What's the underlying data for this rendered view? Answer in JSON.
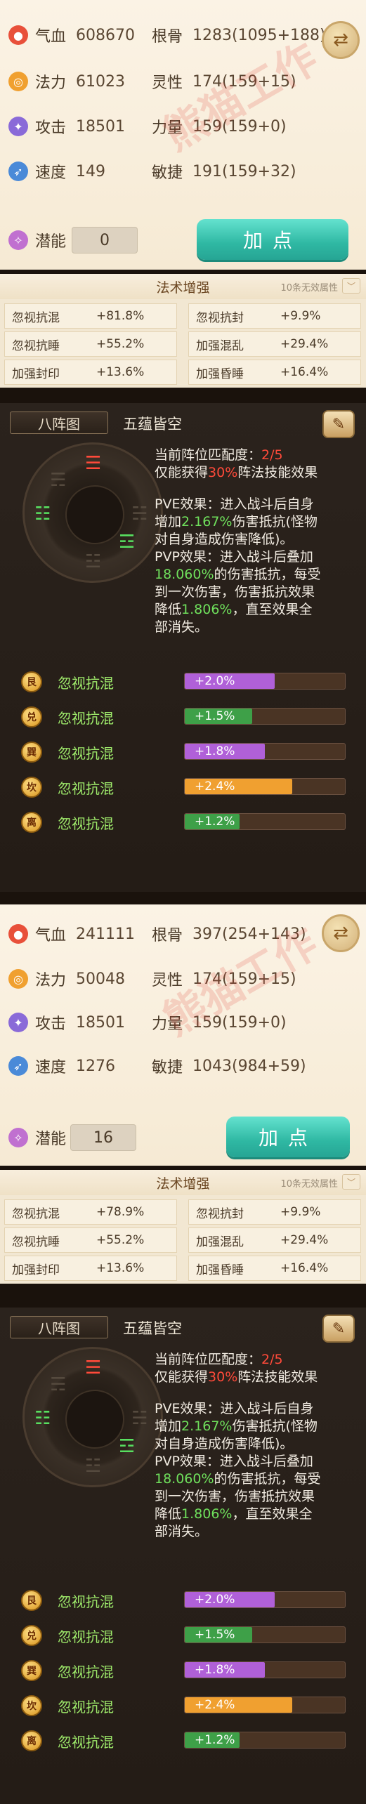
{
  "screens": [
    {
      "attrs": {
        "hp_label": "气血",
        "hp_value": "608670",
        "mp_label": "法力",
        "mp_value": "61023",
        "atk_label": "攻击",
        "atk_value": "18501",
        "spd_label": "速度",
        "spd_value": "149",
        "str_label": "根骨",
        "str_value": "1283(1095+188)",
        "mag_label": "灵性",
        "mag_value": "174(159+15)",
        "pow_label": "力量",
        "pow_value": "159(159+0)",
        "agi_label": "敏捷",
        "agi_value": "191(159+32)",
        "pot_label": "潜能",
        "pot_value": "0",
        "add_label": "加点"
      },
      "magic": {
        "title": "法术增强",
        "hint": "10条无效属性",
        "cells": [
          {
            "name": "忽视抗混",
            "value": "+81.8%"
          },
          {
            "name": "忽视抗封",
            "value": "+9.9%"
          },
          {
            "name": "忽视抗睡",
            "value": "+55.2%"
          },
          {
            "name": "加强混乱",
            "value": "+29.4%"
          },
          {
            "name": "加强封印",
            "value": "+13.6%"
          },
          {
            "name": "加强昏睡",
            "value": "+16.4%"
          }
        ]
      }
    },
    {
      "attrs": {
        "hp_label": "气血",
        "hp_value": "241111",
        "mp_label": "法力",
        "mp_value": "50048",
        "atk_label": "攻击",
        "atk_value": "18501",
        "spd_label": "速度",
        "spd_value": "1276",
        "str_label": "根骨",
        "str_value": "397(254+143)",
        "mag_label": "灵性",
        "mag_value": "174(159+15)",
        "pow_label": "力量",
        "pow_value": "159(159+0)",
        "agi_label": "敏捷",
        "agi_value": "1043(984+59)",
        "pot_label": "潜能",
        "pot_value": "16",
        "add_label": "加点"
      },
      "magic": {
        "title": "法术增强",
        "hint": "10条无效属性",
        "cells": [
          {
            "name": "忽视抗混",
            "value": "+78.9%"
          },
          {
            "name": "忽视抗封",
            "value": "+9.9%"
          },
          {
            "name": "忽视抗睡",
            "value": "+55.2%"
          },
          {
            "name": "加强混乱",
            "value": "+29.4%"
          },
          {
            "name": "加强封印",
            "value": "+13.6%"
          },
          {
            "name": "加强昏睡",
            "value": "+16.4%"
          }
        ]
      }
    }
  ],
  "bazhen": {
    "title": "八阵图",
    "name": "五蕴皆空",
    "match_prefix": "当前阵位匹配度：",
    "match_value": "2/5",
    "only_prefix": "仅能获得",
    "only_pct": "30%",
    "only_suffix": "阵法技能效果",
    "pve_1": "PVE效果：进入战斗后自身",
    "pve_2a": "增加",
    "pve_2b": "2.167%",
    "pve_2c": "伤害抵抗(怪物",
    "pve_3": "对自身造成伤害降低)。",
    "pvp_1": "PVP效果：进入战斗后叠加",
    "pvp_2a": "18.060%",
    "pvp_2b": "的伤害抵抗，每受",
    "pvp_3": "到一次伤害，伤害抵抗效果",
    "pvp_4a": "降低",
    "pvp_4b": "1.806%",
    "pvp_4c": "，直至效果全",
    "pvp_5": "部消失。",
    "rows": [
      {
        "glyph": "艮",
        "name": "忽视抗混",
        "value": "+2.0%",
        "level": 0.56,
        "color": "#b060d8"
      },
      {
        "glyph": "兑",
        "name": "忽视抗混",
        "value": "+1.5%",
        "level": 0.42,
        "color": "#3ea048"
      },
      {
        "glyph": "巽",
        "name": "忽视抗混",
        "value": "+1.8%",
        "level": 0.5,
        "color": "#b060d8"
      },
      {
        "glyph": "坎",
        "name": "忽视抗混",
        "value": "+2.4%",
        "level": 0.67,
        "color": "#f0a030"
      },
      {
        "glyph": "离",
        "name": "忽视抗混",
        "value": "+1.2%",
        "level": 0.34,
        "color": "#3ea048"
      }
    ]
  },
  "watermark": "熊猫工作"
}
